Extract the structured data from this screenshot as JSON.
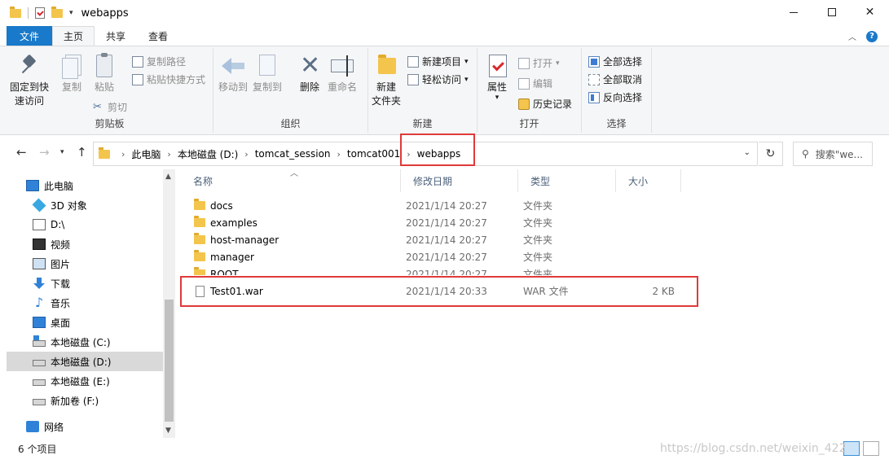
{
  "window": {
    "title": "webapps",
    "minimize": "—",
    "close": "✕"
  },
  "ribbon_tabs": [
    "文件",
    "主页",
    "共享",
    "查看"
  ],
  "ribbon": {
    "clipboard": {
      "label": "剪贴板",
      "pin_quick_access": "固定到快\n速访问",
      "copy": "复制",
      "paste": "粘贴",
      "copy_path": "复制路径",
      "paste_shortcut": "粘贴快捷方式",
      "cut": "剪切"
    },
    "organize": {
      "label": "组织",
      "move_to": "移动到",
      "copy_to": "复制到",
      "delete": "删除",
      "rename": "重命名"
    },
    "new": {
      "label": "新建",
      "new_folder": "新建\n文件夹",
      "new_item": "新建项目",
      "easy_access": "轻松访问"
    },
    "open": {
      "label": "打开",
      "properties": "属性",
      "open": "打开",
      "edit": "编辑",
      "history": "历史记录"
    },
    "select": {
      "label": "选择",
      "select_all": "全部选择",
      "select_none": "全部取消",
      "invert": "反向选择"
    }
  },
  "address": {
    "crumbs": [
      "此电脑",
      "本地磁盘 (D:)",
      "tomcat_session",
      "tomcat001",
      "webapps"
    ],
    "search_placeholder": "搜索\"we..."
  },
  "sidebar": {
    "items": [
      {
        "label": "此电脑",
        "icon": "pc-icon",
        "indent": 0
      },
      {
        "label": "3D 对象",
        "icon": "cube-icon",
        "indent": 1
      },
      {
        "label": "D:\\",
        "icon": "drive-icon",
        "indent": 1
      },
      {
        "label": "视频",
        "icon": "video-icon",
        "indent": 1
      },
      {
        "label": "图片",
        "icon": "picture-icon",
        "indent": 1
      },
      {
        "label": "下载",
        "icon": "download-icon",
        "indent": 1
      },
      {
        "label": "音乐",
        "icon": "music-icon",
        "indent": 1
      },
      {
        "label": "桌面",
        "icon": "desktop-icon",
        "indent": 1
      },
      {
        "label": "本地磁盘 (C:)",
        "icon": "disk-c-icon",
        "indent": 1
      },
      {
        "label": "本地磁盘 (D:)",
        "icon": "disk-icon",
        "indent": 1,
        "selected": true
      },
      {
        "label": "本地磁盘 (E:)",
        "icon": "disk-icon",
        "indent": 1
      },
      {
        "label": "新加卷 (F:)",
        "icon": "disk-icon",
        "indent": 1
      },
      {
        "label": "网络",
        "icon": "network-icon",
        "indent": 0
      }
    ]
  },
  "file_list": {
    "columns": [
      "名称",
      "修改日期",
      "类型",
      "大小"
    ],
    "rows": [
      {
        "name": "docs",
        "date": "2021/1/14 20:27",
        "type": "文件夹",
        "size": "",
        "icon": "folder-icon"
      },
      {
        "name": "examples",
        "date": "2021/1/14 20:27",
        "type": "文件夹",
        "size": "",
        "icon": "folder-icon"
      },
      {
        "name": "host-manager",
        "date": "2021/1/14 20:27",
        "type": "文件夹",
        "size": "",
        "icon": "folder-icon"
      },
      {
        "name": "manager",
        "date": "2021/1/14 20:27",
        "type": "文件夹",
        "size": "",
        "icon": "folder-icon"
      },
      {
        "name": "ROOT",
        "date": "2021/1/14 20:27",
        "type": "文件夹",
        "size": "",
        "icon": "folder-icon"
      },
      {
        "name": "Test01.war",
        "date": "2021/1/14 20:33",
        "type": "WAR 文件",
        "size": "2 KB",
        "icon": "file-icon"
      }
    ]
  },
  "status": {
    "item_count": "6 个项目"
  },
  "watermark": "https://blog.csdn.net/weixin_422"
}
